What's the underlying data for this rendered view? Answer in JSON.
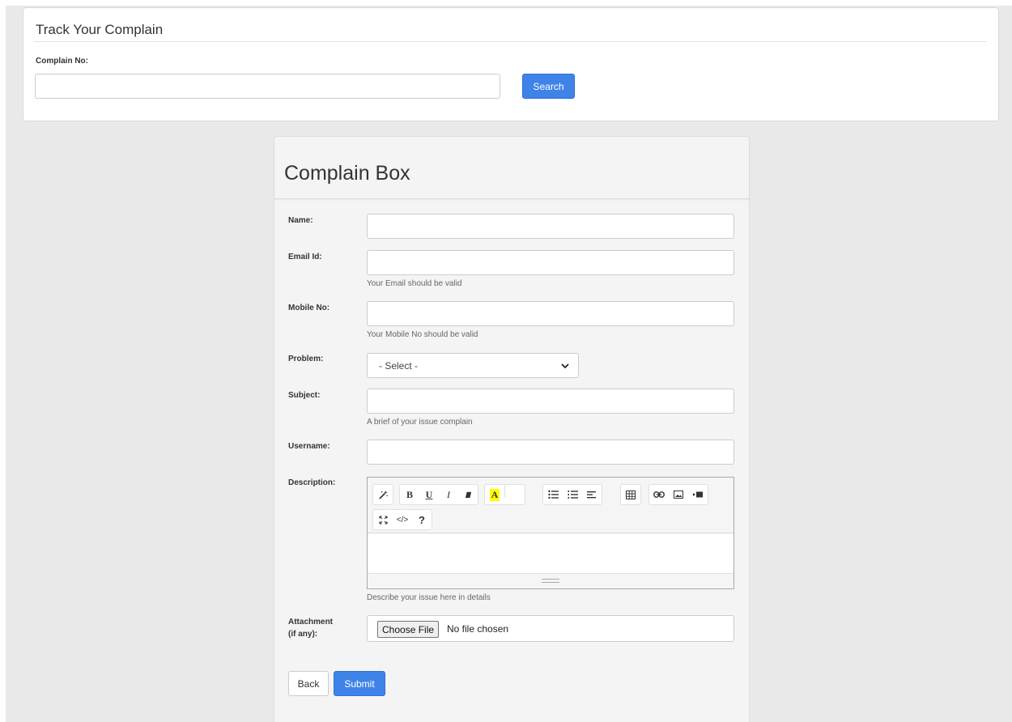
{
  "track": {
    "title": "Track Your Complain",
    "label": "Complain No:",
    "input_value": "",
    "search_label": "Search"
  },
  "complain_box": {
    "title": "Complain Box",
    "fields": {
      "name": {
        "label": "Name:",
        "value": ""
      },
      "email": {
        "label": "Email Id:",
        "value": "",
        "help": "Your Email should be valid"
      },
      "mobile": {
        "label": "Mobile No:",
        "value": "",
        "help": "Your Mobile No should be valid"
      },
      "problem": {
        "label": "Problem:",
        "selected": "- Select -"
      },
      "subject": {
        "label": "Subject:",
        "value": "",
        "help": "A brief of your issue complain"
      },
      "username": {
        "label": "Username:",
        "value": ""
      },
      "description": {
        "label": "Description:",
        "help": "Describe your issue here in details"
      },
      "attachment": {
        "label_line1": "Attachment",
        "label_line2": "(if any):",
        "button": "Choose File",
        "status": "No file chosen"
      }
    },
    "editor_toolbar": {
      "row1": [
        [
          "magic-wand-icon"
        ],
        [
          "bold-icon",
          "underline-icon",
          "italic-icon",
          "eraser-icon"
        ],
        [
          "text-color-icon"
        ],
        [
          "unordered-list-icon",
          "ordered-list-icon",
          "align-icon"
        ],
        [
          "table-icon"
        ],
        [
          "link-icon",
          "picture-icon",
          "video-icon"
        ]
      ],
      "row2": [
        [
          "fullscreen-icon",
          "code-view-icon",
          "help-icon"
        ]
      ],
      "glyphs": {
        "bold": "B",
        "underline": "U",
        "italic": "I",
        "color": "A",
        "code": "</>",
        "help": "?"
      },
      "highlight_color": "#ffff00"
    },
    "buttons": {
      "back": "Back",
      "submit": "Submit"
    }
  },
  "colors": {
    "primary": "#3f83e8",
    "background": "#e9e9e9",
    "panel": "#ffffff",
    "box": "#f4f4f4"
  }
}
